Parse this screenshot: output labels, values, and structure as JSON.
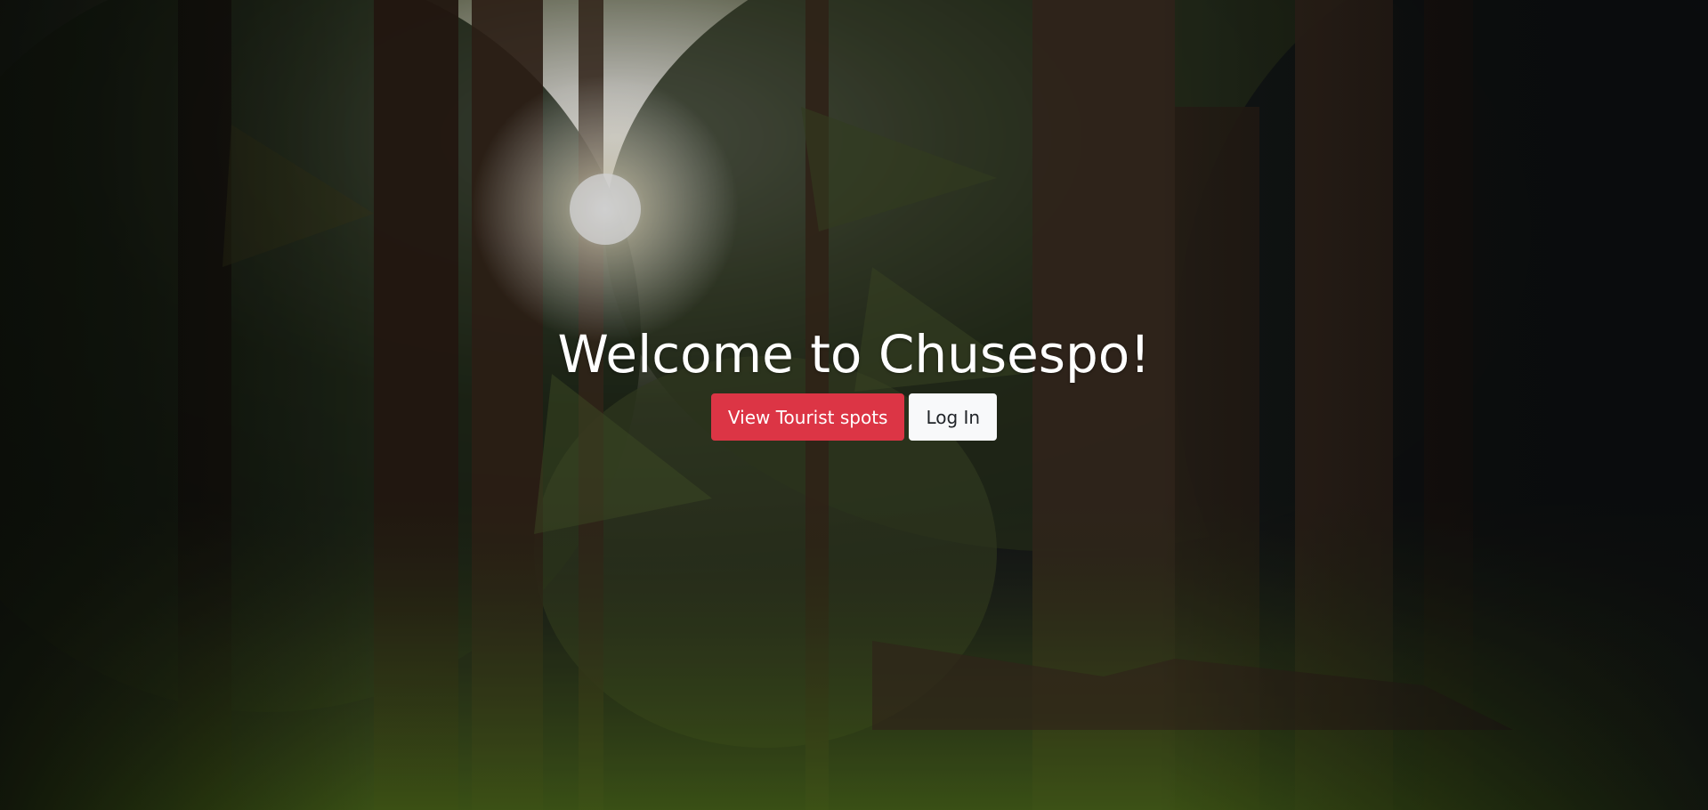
{
  "hero": {
    "title": "Welcome to Chusespo!",
    "background_icon": "forest-photo-icon",
    "buttons": {
      "view_spots_label": "View Tourist spots",
      "login_label": "Log In"
    }
  },
  "colors": {
    "primary": "#dc3545",
    "light": "#f8f9fa",
    "title_text": "#ffffff"
  }
}
